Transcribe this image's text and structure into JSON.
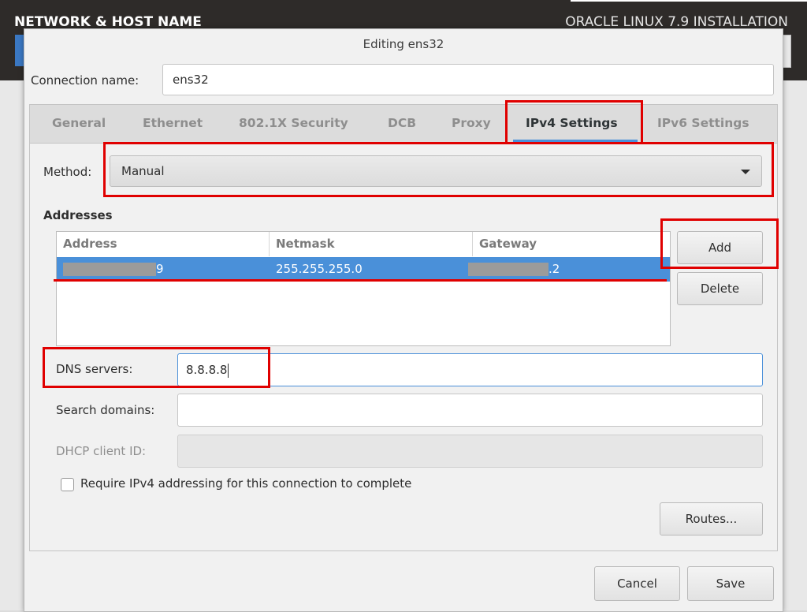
{
  "background": {
    "screen_title": "NETWORK & HOST NAME",
    "installer_title": "ORACLE LINUX 7.9 INSTALLATION"
  },
  "dialog": {
    "title": "Editing ens32",
    "connection_name_label": "Connection name:",
    "connection_name_value": "ens32"
  },
  "tabs": [
    {
      "label": "General",
      "active": false
    },
    {
      "label": "Ethernet",
      "active": false
    },
    {
      "label": "802.1X Security",
      "active": false
    },
    {
      "label": "DCB",
      "active": false
    },
    {
      "label": "Proxy",
      "active": false
    },
    {
      "label": "IPv4 Settings",
      "active": true
    },
    {
      "label": "IPv6 Settings",
      "active": false
    }
  ],
  "ipv4": {
    "method_label": "Method:",
    "method_value": "Manual",
    "addresses_heading": "Addresses",
    "columns": [
      "Address",
      "Netmask",
      "Gateway"
    ],
    "rows": [
      {
        "address_visible_suffix": "9",
        "netmask": "255.255.255.0",
        "gateway_visible_suffix": ".2"
      }
    ],
    "add_label": "Add",
    "delete_label": "Delete",
    "dns_label": "DNS servers:",
    "dns_value": "8.8.8.8",
    "search_label": "Search domains:",
    "search_value": "",
    "dhcp_label": "DHCP client ID:",
    "dhcp_value": "",
    "require_label": "Require IPv4 addressing for this connection to complete",
    "require_checked": false,
    "routes_label": "Routes..."
  },
  "footer": {
    "cancel_label": "Cancel",
    "save_label": "Save"
  },
  "colors": {
    "accent": "#4a90d9",
    "highlight": "#e00000"
  }
}
